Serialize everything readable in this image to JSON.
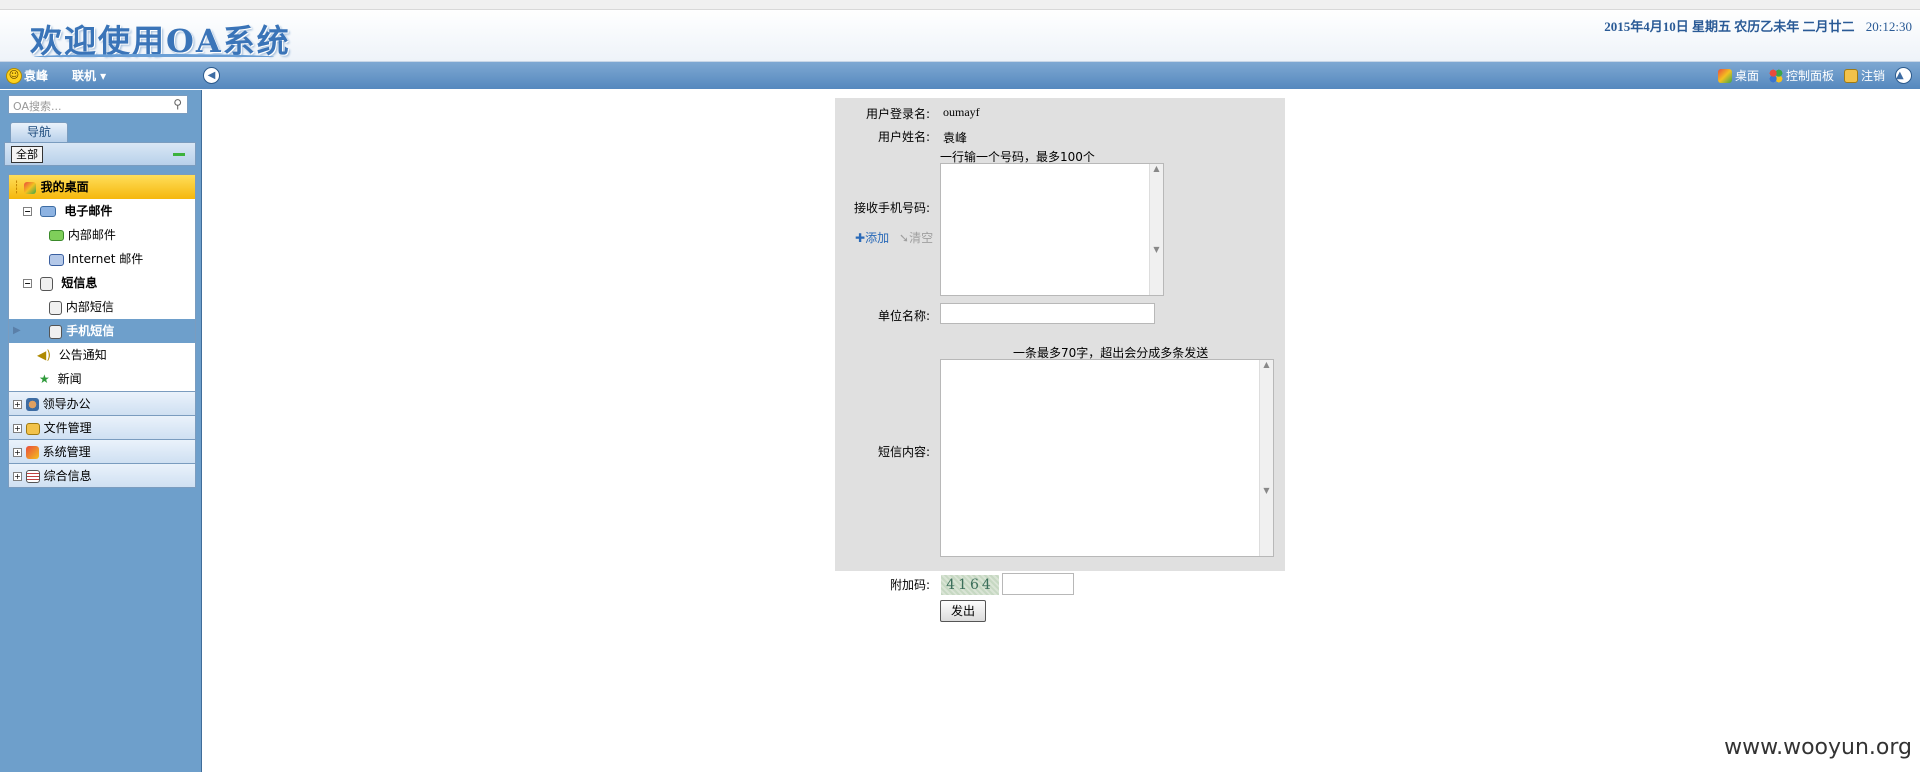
{
  "header": {
    "title": "欢迎使用OA系统",
    "date": "2015年4月10日  星期五  农历乙未年  二月廿二",
    "time": "20:12:30"
  },
  "toolbar": {
    "user_name": "袁峰",
    "online_status": "联机 ▾",
    "collapse_icon": "◀",
    "desktop_label": "桌面",
    "control_panel_label": "控制面板",
    "logout_label": "注销",
    "up_icon": "▲"
  },
  "sidebar": {
    "search_placeholder": "OA搜索...",
    "nav_tab": "导航",
    "all_button": "全部",
    "tree": [
      {
        "label": "我的桌面"
      },
      {
        "label": "电子邮件"
      },
      {
        "label": "内部邮件"
      },
      {
        "label": "Internet 邮件"
      },
      {
        "label": "短信息"
      },
      {
        "label": "内部短信"
      },
      {
        "label": "手机短信"
      },
      {
        "label": "公告通知"
      },
      {
        "label": "新闻"
      },
      {
        "label": "领导办公"
      },
      {
        "label": "文件管理"
      },
      {
        "label": "系统管理"
      },
      {
        "label": "综合信息"
      }
    ]
  },
  "form": {
    "login_label": "用户登录名:",
    "login_value": "oumayf",
    "name_label": "用户姓名:",
    "name_value": "袁峰",
    "phone_hint": "一行输一个号码，最多100个",
    "phone_label": "接收手机号码:",
    "add_label": "添加",
    "clear_label": "清空",
    "unit_label": "单位名称:",
    "content_hint": "一条最多70字，超出会分成多条发送",
    "content_label": "短信内容:",
    "captcha_label": "附加码:",
    "captcha_value": "4164",
    "send_label": "发出"
  },
  "watermark": "www.wooyun.org"
}
